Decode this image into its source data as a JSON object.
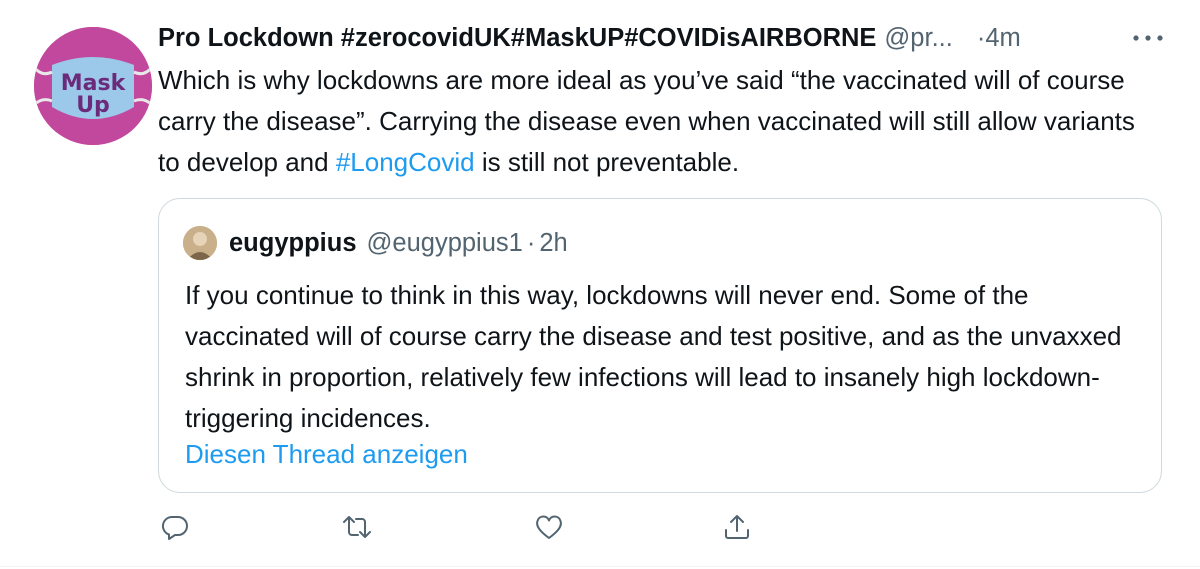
{
  "tweet": {
    "avatar_text_line1": "Mask",
    "avatar_text_line2": "Up",
    "author_name": "Pro Lockdown #zerocovidUK#MaskUP#COVIDisAIRBORNE",
    "handle": "@pr...",
    "time": "·4m",
    "text_before": "Which is why lockdowns are more ideal as you’ve said “the vaccinated will of course carry the disease”. Carrying the disease even when vaccinated will still allow variants to develop and ",
    "hashtag": "#LongCovid",
    "text_after": " is still not preventable."
  },
  "quote": {
    "author_name": "eugyppius",
    "handle": "@eugyppius1",
    "separator": "·",
    "time": "2h",
    "text": "If you continue to think in this way, lockdowns will never end. Some of the vaccinated will of course carry the disease and test positive, and as the unvaxxed shrink in proportion, relatively few infections will lead to insanely high lockdown-triggering incidences.",
    "show_thread": "Diesen Thread anzeigen"
  },
  "icons": {
    "more": "more-horizontal-icon",
    "reply": "reply-icon",
    "retweet": "retweet-icon",
    "like": "like-icon",
    "share": "share-icon"
  },
  "colors": {
    "text": "#0f1419",
    "secondary": "#536471",
    "link": "#1d9bf0",
    "border": "#cfd9de",
    "avatar_bg": "#c2489d",
    "mask_blue": "#9cc8ea"
  }
}
